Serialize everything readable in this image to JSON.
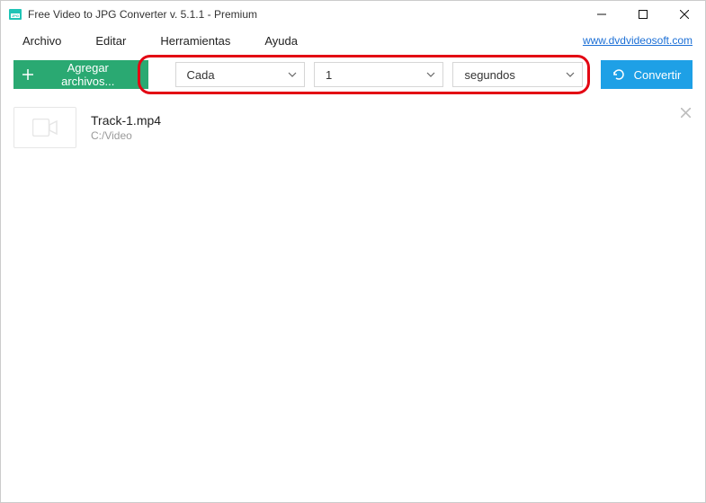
{
  "titlebar": {
    "title": "Free Video to JPG Converter v. 5.1.1 - Premium"
  },
  "menubar": {
    "items": [
      "Archivo",
      "Editar",
      "Herramientas",
      "Ayuda"
    ],
    "link": "www.dvdvideosoft.com"
  },
  "toolbar": {
    "add_label": "Agregar archivos...",
    "dropdown_mode": "Cada",
    "dropdown_value": "1",
    "dropdown_unit": "segundos",
    "convert_label": "Convertir"
  },
  "files": [
    {
      "name": "Track-1.mp4",
      "path": "C:/Video"
    }
  ]
}
